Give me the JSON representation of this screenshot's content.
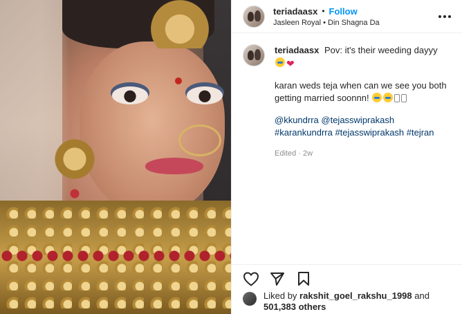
{
  "post": {
    "username": "teriadaasx",
    "follow_label": "Follow",
    "audio": "Jasleen Royal • Din Shagna Da"
  },
  "caption": {
    "username": "teriadaasx",
    "line1": "Pov: it's their weeding dayyy",
    "line2": "karan weds teja when can we see you both getting married soonnn!",
    "mentions": "@kkundrra @tejasswiprakash",
    "hashtags": "#karankundrra #tejasswiprakash #tejran",
    "meta": "Edited · 2w"
  },
  "likes": {
    "prefix": "Liked by",
    "user": "rakshit_goel_rakshu_1998",
    "and": "and",
    "count": "501,383 others"
  },
  "icons": {
    "more": "more-icon",
    "like": "heart-outline-icon",
    "share": "share-icon",
    "save": "bookmark-icon"
  },
  "colors": {
    "follow": "#0095f6",
    "tag": "#00376b",
    "muted": "#8e8e8e"
  }
}
